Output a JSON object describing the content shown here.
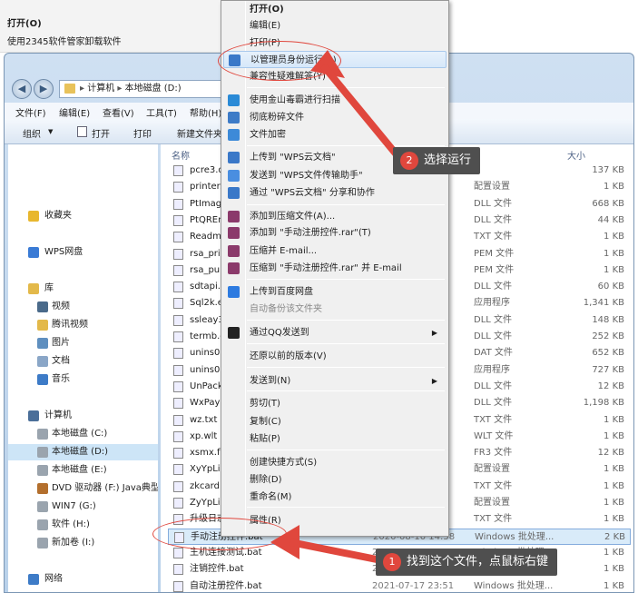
{
  "background_dialog": {
    "title": "打开(O)",
    "subtitle": "使用2345软件管家卸载软件"
  },
  "explorer": {
    "address": [
      "计算机",
      "本地磁盘 (D:)"
    ],
    "menubar": [
      "文件(F)",
      "编辑(E)",
      "查看(V)",
      "工具(T)",
      "帮助(H)"
    ],
    "toolbar": [
      "组织",
      "打开",
      "打印",
      "新建文件夹"
    ],
    "sidebar": [
      {
        "label": "收藏夹",
        "icon": "star-icon",
        "color": "#e8b72e"
      },
      {
        "label": "WPS网盘",
        "icon": "cloud-icon",
        "color": "#3a7bd5"
      },
      {
        "label": "库",
        "icon": "library-icon",
        "color": "#e3b94a"
      },
      {
        "label": "视频",
        "icon": "video-icon",
        "color": "#4a6a8a"
      },
      {
        "label": "腾讯视频",
        "icon": "folder-icon",
        "color": "#e3b94a"
      },
      {
        "label": "图片",
        "icon": "picture-icon",
        "color": "#5f8fbf"
      },
      {
        "label": "文档",
        "icon": "document-icon",
        "color": "#8aa6c7"
      },
      {
        "label": "音乐",
        "icon": "music-icon",
        "color": "#3d7bc7"
      },
      {
        "label": "计算机",
        "icon": "computer-icon",
        "color": "#4b6f99"
      },
      {
        "label": "本地磁盘 (C:)",
        "icon": "drive-icon",
        "color": "#9aa4ae"
      },
      {
        "label": "本地磁盘 (D:)",
        "icon": "drive-icon",
        "color": "#9aa4ae"
      },
      {
        "label": "本地磁盘 (E:)",
        "icon": "drive-icon",
        "color": "#9aa4ae"
      },
      {
        "label": "DVD 驱动器 (F:) Java典型",
        "icon": "dvd-icon",
        "color": "#b36f2d"
      },
      {
        "label": "WIN7 (G:)",
        "icon": "drive-icon",
        "color": "#9aa4ae"
      },
      {
        "label": "软件 (H:)",
        "icon": "drive-icon",
        "color": "#9aa4ae"
      },
      {
        "label": "新加卷 (I:)",
        "icon": "drive-icon",
        "color": "#9aa4ae"
      },
      {
        "label": "网络",
        "icon": "network-icon",
        "color": "#3d7bc7"
      }
    ],
    "columns": {
      "name": "名称",
      "size": "大小"
    },
    "files": [
      {
        "name": "pcre3.d",
        "date": "",
        "type": "",
        "size": "137 KB"
      },
      {
        "name": "printer.",
        "date": "14",
        "type": "配置设置",
        "size": "1 KB"
      },
      {
        "name": "PtImag",
        "date": "28",
        "type": "DLL 文件",
        "size": "668 KB"
      },
      {
        "name": "PtQREn",
        "date": "28",
        "type": "DLL 文件",
        "size": "44 KB"
      },
      {
        "name": "Readm",
        "date": "39",
        "type": "TXT 文件",
        "size": "1 KB"
      },
      {
        "name": "rsa_priv",
        "date": "29",
        "type": "PEM 文件",
        "size": "1 KB"
      },
      {
        "name": "rsa_pub",
        "date": "29",
        "type": "PEM 文件",
        "size": "1 KB"
      },
      {
        "name": "sdtapi.c",
        "date": "00",
        "type": "DLL 文件",
        "size": "60 KB"
      },
      {
        "name": "Sql2k.e",
        "date": "47",
        "type": "应用程序",
        "size": "1,341 KB"
      },
      {
        "name": "ssleay3",
        "date": "30",
        "type": "DLL 文件",
        "size": "148 KB"
      },
      {
        "name": "termb.c",
        "date": "51",
        "type": "DLL 文件",
        "size": "252 KB"
      },
      {
        "name": "unins00",
        "date": "09",
        "type": "DAT 文件",
        "size": "652 KB"
      },
      {
        "name": "unins00",
        "date": "37",
        "type": "应用程序",
        "size": "727 KB"
      },
      {
        "name": "UnPack",
        "date": "30",
        "type": "DLL 文件",
        "size": "12 KB"
      },
      {
        "name": "WxPayD",
        "date": "30",
        "type": "DLL 文件",
        "size": "1,198 KB"
      },
      {
        "name": "wz.txt",
        "date": "42",
        "type": "TXT 文件",
        "size": "1 KB"
      },
      {
        "name": "xp.wlt",
        "date": "43",
        "type": "WLT 文件",
        "size": "1 KB"
      },
      {
        "name": "xsmx.fr",
        "date": "05",
        "type": "FR3 文件",
        "size": "12 KB"
      },
      {
        "name": "XyYpLis",
        "date": "30",
        "type": "配置设置",
        "size": "1 KB"
      },
      {
        "name": "zkcard.",
        "date": "59",
        "type": "TXT 文件",
        "size": "1 KB"
      },
      {
        "name": "ZyYpLis",
        "date": "30",
        "type": "配置设置",
        "size": "1 KB"
      },
      {
        "name": "升级日志",
        "date": "38",
        "type": "TXT 文件",
        "size": "1 KB"
      },
      {
        "name": "手动注册控件.bat",
        "date": "2020-08-10 14:58",
        "type": "Windows 批处理...",
        "size": "2 KB"
      },
      {
        "name": "主机连接测试.bat",
        "date": "2019-11-24 20:19",
        "type": "Windows 批处理...",
        "size": "1 KB"
      },
      {
        "name": "注销控件.bat",
        "date": "2019-04-12 8:55",
        "type": "Windows 批处理...",
        "size": "1 KB"
      },
      {
        "name": "自动注册控件.bat",
        "date": "2021-07-17 23:51",
        "type": "Windows 批处理...",
        "size": "1 KB"
      }
    ]
  },
  "context_menu": {
    "items": [
      {
        "label": "打开(O)",
        "bold": true
      },
      {
        "label": "编辑(E)"
      },
      {
        "label": "打印(P)"
      },
      {
        "label": "以管理员身份运行(A)",
        "icon": "shield-icon",
        "highlight": true
      },
      {
        "label": "兼容性疑难解答(Y)"
      },
      {
        "label": "使用金山毒霸进行扫描",
        "icon": "antivirus-icon"
      },
      {
        "label": "彻底粉碎文件",
        "icon": "shredder-icon"
      },
      {
        "label": "文件加密",
        "icon": "lock-icon"
      },
      {
        "label": "上传到 \"WPS云文档\"",
        "icon": "cloud-upload-icon"
      },
      {
        "label": "发送到 \"WPS文件传输助手\"",
        "icon": "send-icon"
      },
      {
        "label": "通过 \"WPS云文档\" 分享和协作",
        "icon": "share-icon"
      },
      {
        "label": "添加到压缩文件(A)...",
        "icon": "archive-icon"
      },
      {
        "label": "添加到 \"手动注册控件.rar\"(T)",
        "icon": "archive-icon"
      },
      {
        "label": "压缩并 E-mail...",
        "icon": "archive-icon"
      },
      {
        "label": "压缩到 \"手动注册控件.rar\" 并 E-mail",
        "icon": "archive-icon"
      },
      {
        "label": "上传到百度网盘",
        "icon": "baidu-cloud-icon"
      },
      {
        "label": "自动备份该文件夹",
        "dim": true
      },
      {
        "label": "通过QQ发送到",
        "icon": "qq-icon",
        "submenu": true
      },
      {
        "label": "还原以前的版本(V)"
      },
      {
        "label": "发送到(N)",
        "submenu": true
      },
      {
        "label": "剪切(T)"
      },
      {
        "label": "复制(C)"
      },
      {
        "label": "粘贴(P)"
      },
      {
        "label": "创建快捷方式(S)"
      },
      {
        "label": "删除(D)"
      },
      {
        "label": "重命名(M)"
      },
      {
        "label": "属性(R)"
      }
    ],
    "submenu_arrow": "▶"
  },
  "annotations": {
    "step1": {
      "num": "1",
      "text": "找到这个文件，点鼠标右键"
    },
    "step2": {
      "num": "2",
      "text": "选择运行"
    },
    "accent": "#e0473d"
  }
}
